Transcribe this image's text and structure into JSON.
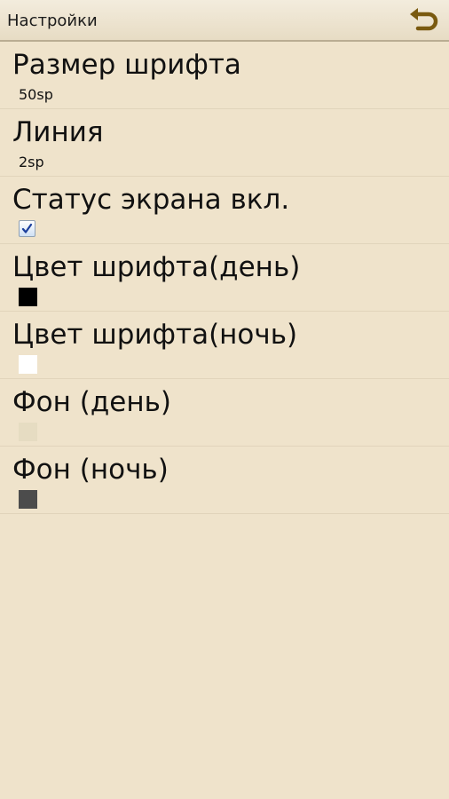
{
  "header": {
    "title": "Настройки",
    "back_icon": "back-arrow-icon",
    "back_icon_color": "#7a5a10"
  },
  "settings": [
    {
      "title": "Размер шрифта",
      "summary": "50sp"
    },
    {
      "title": "Линия",
      "summary": "2sp"
    },
    {
      "title": "Статус экрана вкл.",
      "checked": true
    },
    {
      "title": "Цвет шрифта(день)",
      "color": "#000000"
    },
    {
      "title": "Цвет шрифта(ночь)",
      "color": "#ffffff"
    },
    {
      "title": "Фон (день)",
      "color": "#e6dcc2"
    },
    {
      "title": "Фон (ночь)",
      "color": "#4c4c4c"
    }
  ],
  "colors": {
    "background": "#efe3cb",
    "checkmark": "#1c3f9c"
  }
}
